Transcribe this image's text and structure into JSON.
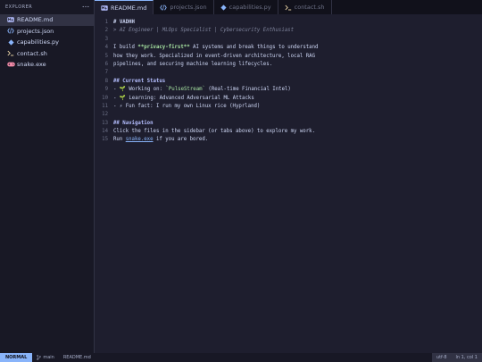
{
  "explorer": {
    "title": "EXPLORER",
    "more_icon": "ellipsis-icon",
    "files": [
      {
        "name": "README.md",
        "icon": "markdown-icon",
        "color": "#b4befe",
        "active": true
      },
      {
        "name": "projects.json",
        "icon": "json-brackets-icon",
        "color": "#89b4fa",
        "active": false
      },
      {
        "name": "capabilities.py",
        "icon": "python-diamond-icon",
        "color": "#89b4fa",
        "active": false
      },
      {
        "name": "contact.sh",
        "icon": "terminal-icon",
        "color": "#f9e2af",
        "active": false
      },
      {
        "name": "snake.exe",
        "icon": "gamepad-icon",
        "color": "#f38ba8",
        "active": false
      }
    ]
  },
  "tabs": [
    {
      "label": "README.md",
      "active": true
    },
    {
      "label": "projects.json",
      "active": false
    },
    {
      "label": "capabilities.py",
      "active": false
    },
    {
      "label": "contact.sh",
      "active": false
    }
  ],
  "editor": {
    "lines": [
      {
        "n": "1",
        "segs": [
          {
            "t": "# VADHH",
            "c": "h1"
          }
        ]
      },
      {
        "n": "2",
        "segs": [
          {
            "t": "> AI Engineer | MLOps Specialist | Cybersecurity Enthusiast",
            "c": "italic"
          }
        ]
      },
      {
        "n": "3",
        "segs": []
      },
      {
        "n": "4",
        "segs": [
          {
            "t": "I build ",
            "c": "txt"
          },
          {
            "t": "**privacy-first**",
            "c": "bold-green"
          },
          {
            "t": " AI systems and break things to understand",
            "c": "txt"
          }
        ]
      },
      {
        "n": "5",
        "segs": [
          {
            "t": "how they work. Specialized in event-driven architecture, local RAG",
            "c": "txt"
          }
        ]
      },
      {
        "n": "6",
        "segs": [
          {
            "t": "pipelines, and securing machine learning lifecycles.",
            "c": "txt"
          }
        ]
      },
      {
        "n": "7",
        "segs": []
      },
      {
        "n": "8",
        "segs": [
          {
            "t": "## Current Status",
            "c": "h2"
          }
        ]
      },
      {
        "n": "9",
        "segs": [
          {
            "t": "- 🌱 Working on: ",
            "c": "txt"
          },
          {
            "t": "`PulseStream`",
            "c": "code"
          },
          {
            "t": " (Real-time Financial Intel)",
            "c": "txt"
          }
        ]
      },
      {
        "n": "10",
        "segs": [
          {
            "t": "- 🌱 Learning: Advanced Adversarial ML Attacks",
            "c": "txt"
          }
        ]
      },
      {
        "n": "11",
        "segs": [
          {
            "t": "- ⚡ Fun fact: I run my own Linux rice (Hyprland)",
            "c": "txt"
          }
        ]
      },
      {
        "n": "12",
        "segs": []
      },
      {
        "n": "13",
        "segs": [
          {
            "t": "## Navigation",
            "c": "h2"
          }
        ]
      },
      {
        "n": "14",
        "segs": [
          {
            "t": "Click the files in the sidebar (or tabs above) to explore my work.",
            "c": "txt"
          }
        ]
      },
      {
        "n": "15",
        "segs": [
          {
            "t": "Run ",
            "c": "txt"
          },
          {
            "t": "snake.exe",
            "c": "link"
          },
          {
            "t": " if you are bored.",
            "c": "txt"
          }
        ]
      }
    ]
  },
  "status": {
    "mode": "NORMAL",
    "branch": "main",
    "branch_icon": "git-branch-icon",
    "file": "README.md",
    "encoding": "utf-8",
    "position": "ln 1, col 1"
  },
  "colors": {
    "accent": "#89b4fa",
    "background": "#1e1e2e",
    "sidebar": "#181825"
  }
}
